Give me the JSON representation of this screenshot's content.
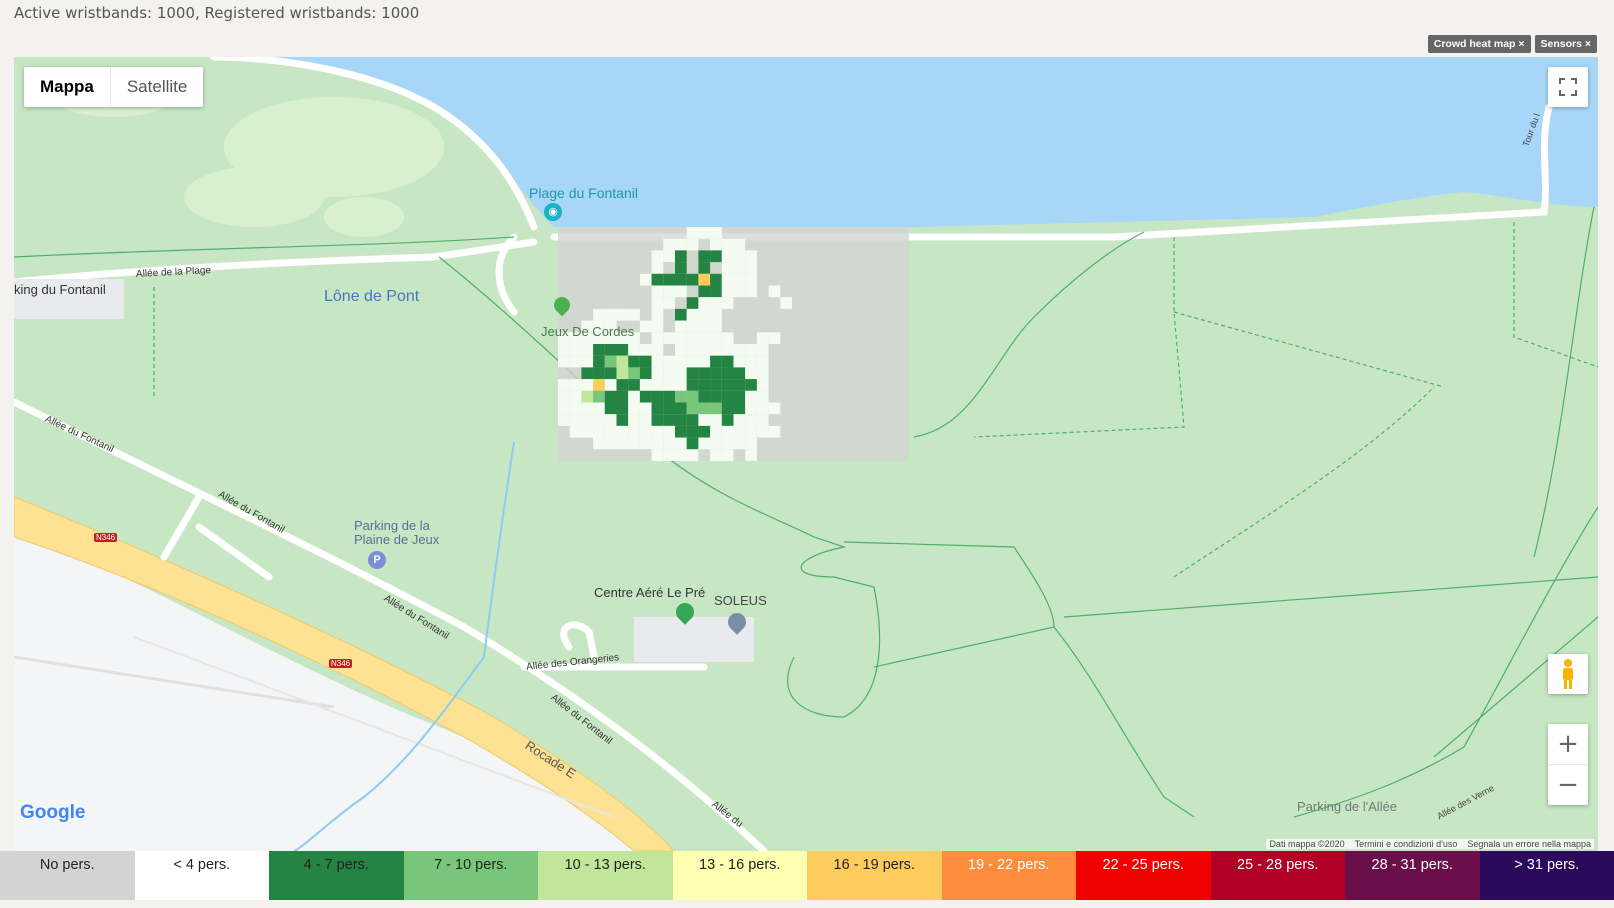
{
  "status": {
    "text": "Active wristbands: 1000, Registered wristbands: 1000"
  },
  "chips": {
    "heatmap": "Crowd heat map ×",
    "sensors": "Sensors ×"
  },
  "map": {
    "type_map": "Mappa",
    "type_satellite": "Satellite",
    "labels": {
      "plage": "Plage du Fontanil",
      "lone": "Lône de Pont",
      "parking_fontanil": "king du Fontanil",
      "allee_plage": "Allée de la Plage",
      "jeux": "Jeux De Cordes",
      "allee_fontanil_1": "Allée du Fontanil",
      "allee_fontanil_2": "Allée du Fontanil",
      "allee_fontanil_3": "Allée du Fontanil",
      "allee_fontanil_4": "Allée du Fontanil",
      "allee_fontanil_5": "Allée du",
      "parking_plaine_1": "Parking de la",
      "parking_plaine_2": "Plaine de Jeux",
      "n346_1": "N346",
      "n346_2": "N346",
      "centre": "Centre Aéré Le Pré",
      "soleus": "SOLEUS",
      "orangeries": "Allée des Orangeries",
      "rocade": "Rocade E",
      "parking_allee": "Parking de l'Allée",
      "allee_vernes": "Allée des Verne",
      "tour": "Tour du l"
    },
    "google": "Google",
    "attrib_data": "Dati mappa ©2020",
    "attrib_terms": "Termini e condizioni d'uso",
    "attrib_report": "Segnala un errore nella mappa",
    "zoom_in": "+",
    "zoom_out": "−"
  },
  "heatmap_cells": {
    "rows": [
      "...........ccc.............",
      ".........cccfccc...........",
      "........ccnfnnccc..........",
      "........cfnfnfccc..........",
      ".......cnnnnynccc..........",
      "........cccfnnccc.c........",
      "........ccfnccc....c.......",
      "...cccc.cfnccc.............",
      "..ccc..ccfcccc.............",
      "ccccccc.ccccccc..cc........",
      "cccnnnccc.cccccccc.........",
      "cccnglnncccccnnccc.........",
      "..nnnlgncccnnnnncc..........",
      "cccycnnccccnnnnnnc.........",
      "cclgnncnnnggnnnncc.........",
      "ccccnnccnnngggnnccc........",
      "cccccnccnnnnccnccc.........",
      ".cccccccccnnncccccc........",
      "...ccccccccnccccc..........",
      "........cccc.cc.c.........."
    ]
  },
  "legend": [
    {
      "label": "No pers.",
      "color": "#d3d3d3",
      "text": "#222"
    },
    {
      "label": "< 4 pers.",
      "color": "#ffffff",
      "text": "#222"
    },
    {
      "label": "4 - 7 pers.",
      "color": "#238443",
      "text": "#222"
    },
    {
      "label": "7 - 10 pers.",
      "color": "#78c679",
      "text": "#222"
    },
    {
      "label": "10 - 13 pers.",
      "color": "#c2e699",
      "text": "#222"
    },
    {
      "label": "13 - 16 pers.",
      "color": "#ffffb2",
      "text": "#222"
    },
    {
      "label": "16 - 19 pers.",
      "color": "#fecc5c",
      "text": "#222"
    },
    {
      "label": "19 - 22 pers.",
      "color": "#fd8d3c",
      "text": "#fff"
    },
    {
      "label": "22 - 25 pers.",
      "color": "#f00000",
      "text": "#fff"
    },
    {
      "label": "25 - 28 pers.",
      "color": "#b10026",
      "text": "#fff"
    },
    {
      "label": "28 - 31 pers.",
      "color": "#6b0f4a",
      "text": "#fff"
    },
    {
      "label": "> 31 pers.",
      "color": "#2b0a5e",
      "text": "#fff"
    }
  ]
}
